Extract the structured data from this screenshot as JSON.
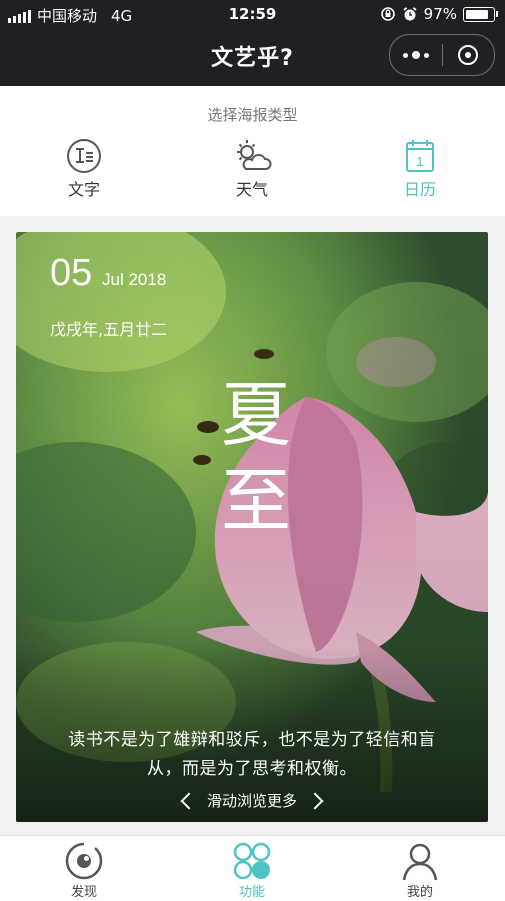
{
  "status_bar": {
    "carrier": "中国移动",
    "network": "4G",
    "time": "12:59",
    "battery": "97%",
    "battery_level": 0.97
  },
  "nav": {
    "title": "文艺乎?"
  },
  "selector": {
    "heading": "选择海报类型",
    "tabs": [
      {
        "label": "文字",
        "icon": "text-icon",
        "active": false
      },
      {
        "label": "天气",
        "icon": "weather-icon",
        "active": false
      },
      {
        "label": "日历",
        "icon": "calendar-icon",
        "active": true
      }
    ],
    "calendar_icon_number": "1"
  },
  "poster": {
    "day": "05",
    "month_year": "Jul 2018",
    "lunar_date": "戊戌年,五月廿二",
    "solar_term": [
      "夏",
      "至"
    ],
    "quote": "读书不是为了雄辩和驳斥，也不是为了轻信和盲从，而是为了思考和权衡。",
    "browse_more": "滑动浏览更多"
  },
  "tabbar": {
    "items": [
      {
        "label": "发现",
        "icon": "discover-icon",
        "active": false
      },
      {
        "label": "功能",
        "icon": "features-icon",
        "active": true
      },
      {
        "label": "我的",
        "icon": "profile-icon",
        "active": false
      }
    ]
  },
  "colors": {
    "accent": "#4ec3c4",
    "nav_bg": "#1f2026"
  }
}
